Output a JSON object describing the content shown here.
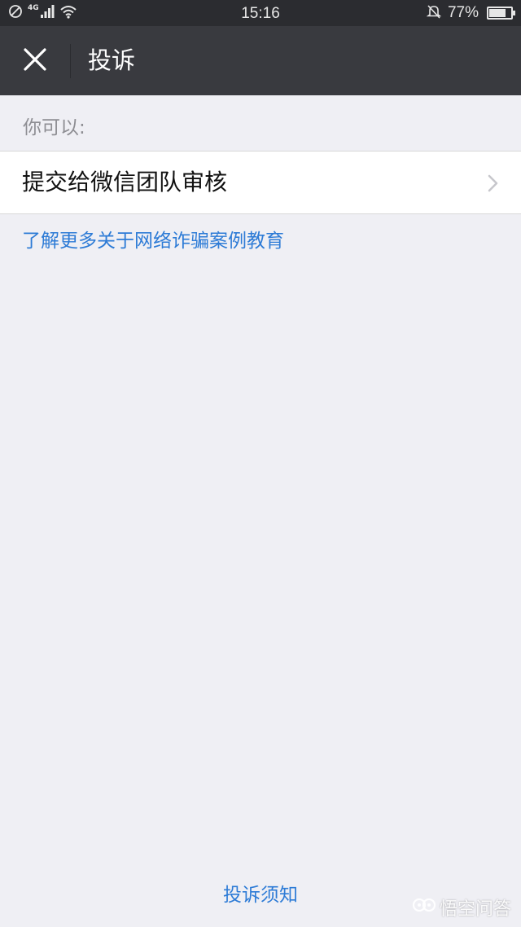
{
  "status_bar": {
    "network": "4G",
    "time": "15:16",
    "battery_percent": "77%",
    "battery_level": 0.77,
    "icons": [
      "no-sim-icon",
      "signal-icon",
      "wifi-icon",
      "mute-bell-icon",
      "battery-icon"
    ]
  },
  "header": {
    "close_icon": "close-icon",
    "title": "投诉"
  },
  "section": {
    "label": "你可以:"
  },
  "options": [
    {
      "label": "提交给微信团队审核",
      "icon": "chevron-right-icon"
    }
  ],
  "link": {
    "label": "了解更多关于网络诈骗案例教育"
  },
  "footer": {
    "link_label": "投诉须知"
  },
  "watermark": {
    "text": "悟空问答"
  },
  "colors": {
    "status_bar_bg": "#2b2c30",
    "header_bg": "#393a3f",
    "page_bg": "#efeff4",
    "link": "#2d7bd6"
  }
}
